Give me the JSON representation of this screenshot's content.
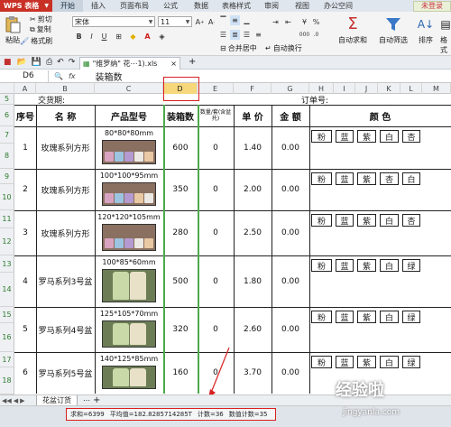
{
  "app": {
    "logo": "WPS 表格",
    "user_button": "未登录"
  },
  "menu": [
    "开始",
    "插入",
    "页面布局",
    "公式",
    "数据",
    "表格样式",
    "审阅",
    "视图",
    "办公空间"
  ],
  "ribbon": {
    "paste": "粘贴",
    "cut": "剪切",
    "copy": "复制",
    "format_painter": "格式刷",
    "font_name": "宋体",
    "font_size": "11",
    "bold": "B",
    "italic": "I",
    "underline": "U",
    "merge": "合并居中",
    "wrap": "自动换行",
    "currency": "¥",
    "percent": "%",
    "thousands": "000",
    "autosum": "自动求和",
    "autofilter": "自动筛选",
    "sort": "排序",
    "format": "格式"
  },
  "file_tab": {
    "name": "\"维罗纳\" 花⋯1).xls",
    "close": "×",
    "add": "+"
  },
  "formula_bar": {
    "cell_ref": "D6",
    "fx": "fx",
    "value": "装箱数"
  },
  "columns": [
    "A",
    "B",
    "C",
    "D",
    "E",
    "F",
    "G",
    "H",
    "I",
    "J",
    "K",
    "L",
    "M"
  ],
  "rows": [
    "5",
    "6",
    "7",
    "8",
    "9",
    "10",
    "11",
    "12",
    "13",
    "14",
    "15",
    "16",
    "17",
    "18"
  ],
  "sheet": {
    "row5": {
      "left": "交货期:",
      "right": "订单号:"
    },
    "headers": {
      "seq": "序号",
      "name": "名   称",
      "model": "产品型号",
      "qty": "装箱数",
      "pack": "数量/套(含盆托)",
      "price": "单 价",
      "amount": "金 额",
      "color": "颜   色"
    },
    "items": [
      {
        "seq": "1",
        "name": "玫瑰系列方形",
        "dim": "80*80*80mm",
        "qty": "600",
        "num": "0",
        "price": "1.40",
        "amount": "0.00",
        "colors": [
          "粉",
          "蓝",
          "紫",
          "白",
          "杏"
        ],
        "pic_colors": [
          "#d8a3c0",
          "#9cc3e0",
          "#b49ad0",
          "#ece9e4",
          "#e8c9a4"
        ]
      },
      {
        "seq": "2",
        "name": "玫瑰系列方形",
        "dim": "100*100*95mm",
        "qty": "350",
        "num": "0",
        "price": "2.00",
        "amount": "0.00",
        "colors": [
          "粉",
          "蓝",
          "紫",
          "杏",
          "白"
        ],
        "pic_colors": [
          "#d8a3c0",
          "#9cc3e0",
          "#b49ad0",
          "#e8c9a4",
          "#ece9e4"
        ]
      },
      {
        "seq": "3",
        "name": "玫瑰系列方形",
        "dim": "120*120*105mm",
        "qty": "280",
        "num": "0",
        "price": "2.50",
        "amount": "0.00",
        "colors": [
          "粉",
          "蓝",
          "紫",
          "白",
          "杏"
        ],
        "pic_colors": [
          "#d8a3c0",
          "#9cc3e0",
          "#b49ad0",
          "#ece9e4",
          "#e8c9a4"
        ]
      },
      {
        "seq": "4",
        "name": "罗马系列3号盆",
        "dim": "100*85*60mm",
        "qty": "500",
        "num": "0",
        "price": "1.80",
        "amount": "0.00",
        "colors": [
          "粉",
          "蓝",
          "紫",
          "白",
          "绿"
        ],
        "pic_colors": [
          "#c9d9a8",
          "#e9e0c8"
        ]
      },
      {
        "seq": "5",
        "name": "罗马系列4号盆",
        "dim": "125*105*70mm",
        "qty": "320",
        "num": "0",
        "price": "2.60",
        "amount": "0.00",
        "colors": [
          "粉",
          "蓝",
          "紫",
          "白",
          "绿"
        ],
        "pic_colors": [
          "#c9d9a8",
          "#e9e0c8"
        ]
      },
      {
        "seq": "6",
        "name": "罗马系列5号盆",
        "dim": "140*125*85mm",
        "qty": "160",
        "num": "0",
        "price": "3.70",
        "amount": "0.00",
        "colors": [
          "粉",
          "蓝",
          "紫",
          "白",
          "绿"
        ],
        "pic_colors": [
          "#c9d9a8",
          "#e9e0c8"
        ]
      }
    ]
  },
  "sheet_tab": "花盆订货",
  "status": {
    "sum": "求和=6399",
    "avg": "平均值=182.8285714285T",
    "count": "计数=36",
    "numcount": "数值计数=35"
  },
  "watermark": {
    "main": "经验啦",
    "sub": "jingyanla.com"
  }
}
